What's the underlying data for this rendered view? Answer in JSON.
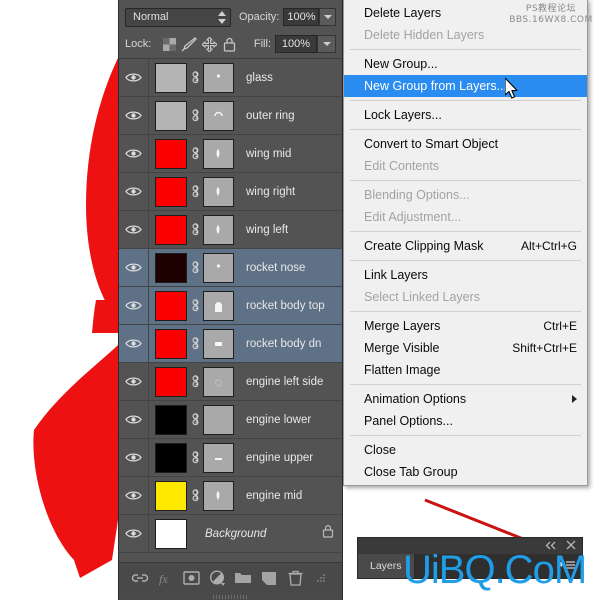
{
  "app": {
    "panel_title": "Layers",
    "watermark_top_line1": "PS教程论坛",
    "watermark_top_line2": "BBS.16WX8.COM",
    "watermark_big": "UiBQ.CoM"
  },
  "colors": {
    "panel_bg": "#535353",
    "row_selected": "#5f7186",
    "menu_bg": "#f0f0f0",
    "menu_highlight": "#2a8cf0",
    "artwork_red": "#ee1111",
    "watermark_blue": "#1f9ee8"
  },
  "panel_top": {
    "blend_mode": "Normal",
    "opacity_label": "Opacity:",
    "opacity_value": "100%",
    "lock_label": "Lock:",
    "fill_label": "Fill:",
    "fill_value": "100%",
    "lock_icons": [
      "transparency-lock-icon",
      "brush-lock-icon",
      "move-lock-icon",
      "all-lock-icon"
    ]
  },
  "layers": [
    {
      "name": "glass",
      "thumb": "#b4b4b4",
      "selected": false,
      "has_mask": true,
      "locked": false
    },
    {
      "name": "outer ring",
      "thumb": "#b4b4b4",
      "selected": false,
      "has_mask": true,
      "locked": false
    },
    {
      "name": "wing mid",
      "thumb": "#fa0000",
      "selected": false,
      "has_mask": true,
      "locked": false
    },
    {
      "name": "wing right",
      "thumb": "#fa0000",
      "selected": false,
      "has_mask": true,
      "locked": false
    },
    {
      "name": "wing left",
      "thumb": "#fa0000",
      "selected": false,
      "has_mask": true,
      "locked": false
    },
    {
      "name": "rocket nose",
      "thumb": "#1e0202",
      "selected": true,
      "has_mask": true,
      "locked": false
    },
    {
      "name": "rocket body top",
      "thumb": "#fa0000",
      "selected": true,
      "has_mask": true,
      "locked": false
    },
    {
      "name": "rocket body dn",
      "thumb": "#fa0000",
      "selected": true,
      "has_mask": true,
      "locked": false
    },
    {
      "name": "engine left side",
      "thumb": "#fa0000",
      "selected": false,
      "has_mask": true,
      "locked": false
    },
    {
      "name": "engine lower",
      "thumb": "#000000",
      "selected": false,
      "has_mask": true,
      "locked": false
    },
    {
      "name": "engine upper",
      "thumb": "#000000",
      "selected": false,
      "has_mask": true,
      "locked": false
    },
    {
      "name": "engine mid",
      "thumb": "#ffe800",
      "selected": false,
      "has_mask": true,
      "locked": false
    },
    {
      "name": "Background",
      "thumb": "#ffffff",
      "selected": false,
      "has_mask": false,
      "locked": true
    }
  ],
  "panel_bottom_icons": [
    "link-layers-icon",
    "layer-style-fx-icon",
    "add-layer-mask-icon",
    "new-adjustment-layer-icon",
    "new-group-icon",
    "new-layer-icon",
    "delete-layer-icon"
  ],
  "context_menu": [
    {
      "label": "Delete Layers",
      "shortcut": "",
      "disabled": false,
      "highlight": false,
      "submenu": false
    },
    {
      "label": "Delete Hidden Layers",
      "shortcut": "",
      "disabled": true,
      "highlight": false,
      "submenu": false
    },
    {
      "separator": true
    },
    {
      "label": "New Group...",
      "shortcut": "",
      "disabled": false,
      "highlight": false,
      "submenu": false
    },
    {
      "label": "New Group from Layers...",
      "shortcut": "",
      "disabled": false,
      "highlight": true,
      "submenu": false
    },
    {
      "separator": true
    },
    {
      "label": "Lock Layers...",
      "shortcut": "",
      "disabled": false,
      "highlight": false,
      "submenu": false
    },
    {
      "separator": true
    },
    {
      "label": "Convert to Smart Object",
      "shortcut": "",
      "disabled": false,
      "highlight": false,
      "submenu": false
    },
    {
      "label": "Edit Contents",
      "shortcut": "",
      "disabled": true,
      "highlight": false,
      "submenu": false
    },
    {
      "separator": true
    },
    {
      "label": "Blending Options...",
      "shortcut": "",
      "disabled": true,
      "highlight": false,
      "submenu": false
    },
    {
      "label": "Edit Adjustment...",
      "shortcut": "",
      "disabled": true,
      "highlight": false,
      "submenu": false
    },
    {
      "separator": true
    },
    {
      "label": "Create Clipping Mask",
      "shortcut": "Alt+Ctrl+G",
      "disabled": false,
      "highlight": false,
      "submenu": false
    },
    {
      "separator": true
    },
    {
      "label": "Link Layers",
      "shortcut": "",
      "disabled": false,
      "highlight": false,
      "submenu": false
    },
    {
      "label": "Select Linked Layers",
      "shortcut": "",
      "disabled": true,
      "highlight": false,
      "submenu": false
    },
    {
      "separator": true
    },
    {
      "label": "Merge Layers",
      "shortcut": "Ctrl+E",
      "disabled": false,
      "highlight": false,
      "submenu": false
    },
    {
      "label": "Merge Visible",
      "shortcut": "Shift+Ctrl+E",
      "disabled": false,
      "highlight": false,
      "submenu": false
    },
    {
      "label": "Flatten Image",
      "shortcut": "",
      "disabled": false,
      "highlight": false,
      "submenu": false
    },
    {
      "separator": true
    },
    {
      "label": "Animation Options",
      "shortcut": "",
      "disabled": false,
      "highlight": false,
      "submenu": true
    },
    {
      "label": "Panel Options...",
      "shortcut": "",
      "disabled": false,
      "highlight": false,
      "submenu": false
    },
    {
      "separator": true
    },
    {
      "label": "Close",
      "shortcut": "",
      "disabled": false,
      "highlight": false,
      "submenu": false
    },
    {
      "label": "Close Tab Group",
      "shortcut": "",
      "disabled": false,
      "highlight": false,
      "submenu": false
    }
  ],
  "dock": {
    "tab_label": "Layers",
    "collapse_icon": "double-chevron-left-icon",
    "close_icon": "close-icon",
    "menu_icon": "panel-menu-icon"
  },
  "annotations": [
    {
      "name": "arrow-to-selected-layers"
    },
    {
      "name": "arrow-to-panel-menu"
    }
  ]
}
